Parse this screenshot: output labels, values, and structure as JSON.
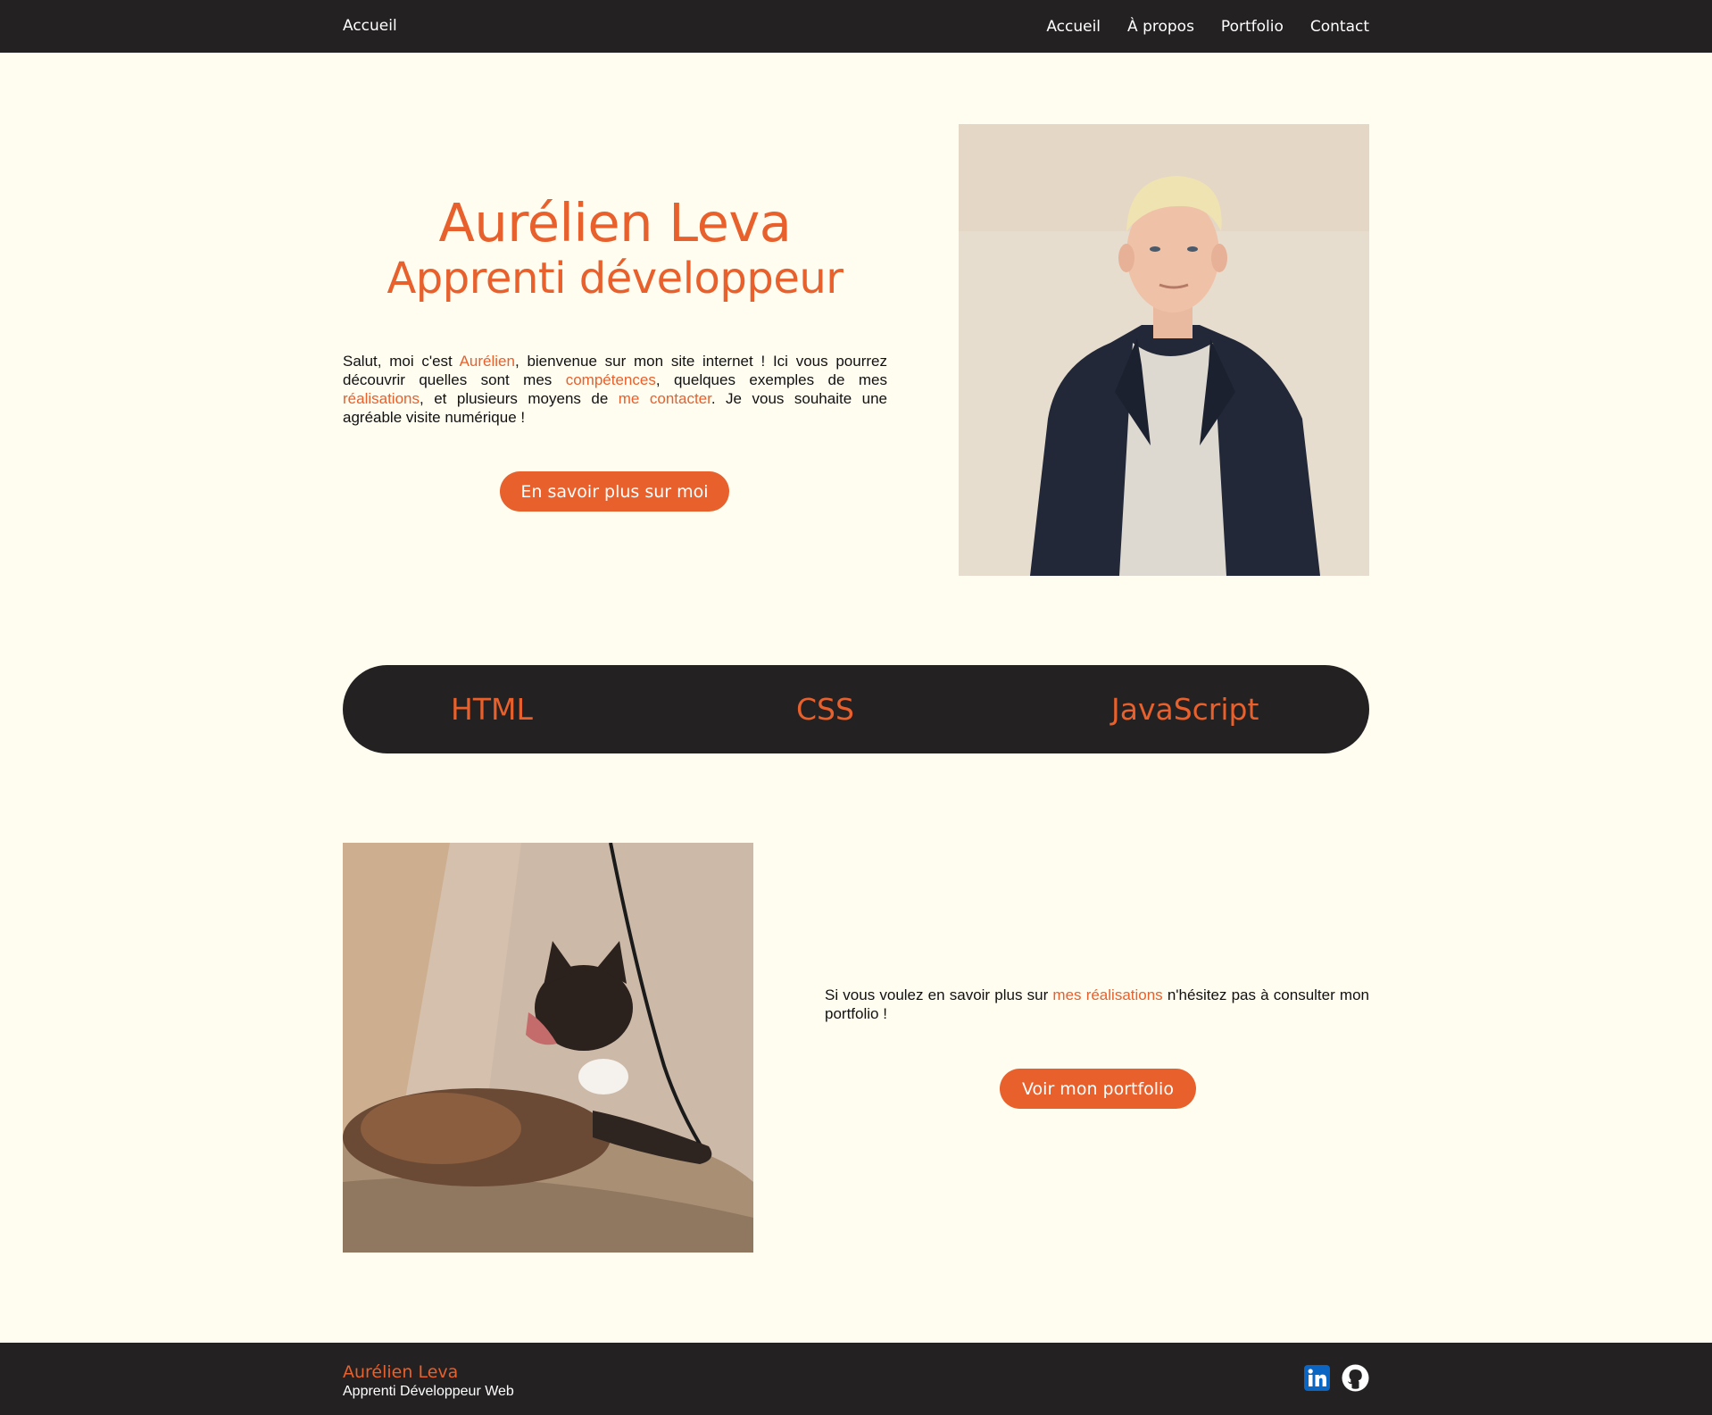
{
  "nav": {
    "home": "Accueil",
    "links": [
      "Accueil",
      "À propos",
      "Portfolio",
      "Contact"
    ]
  },
  "hero": {
    "name": "Aurélien Leva",
    "role": "Apprenti développeur",
    "intro": {
      "t1": "Salut, moi c'est ",
      "link_name": "Aurélien",
      "t2": ", bienvenue sur mon site internet ! Ici vous pourrez découvrir quelles sont mes ",
      "link_skills": "compétences",
      "t3": ", quelques exemples de mes ",
      "link_works": "réalisations",
      "t4": ", et plusieurs moyens de ",
      "link_contact": "me contacter",
      "t5": ". Je vous souhaite une agréable visite numérique !"
    },
    "button": "En savoir plus sur moi"
  },
  "skills": [
    "HTML",
    "CSS",
    "JavaScript"
  ],
  "portfolio": {
    "t1": "Si vous voulez en savoir plus sur ",
    "link": "mes réalisations",
    "t2": " n'hésitez pas à consulter mon portfolio !",
    "button": "Voir mon portfolio"
  },
  "footer": {
    "name": "Aurélien Leva",
    "role": "Apprenti Développeur Web",
    "icons": [
      "linkedin-icon",
      "github-icon"
    ]
  },
  "colors": {
    "accent": "#e8602c",
    "dark": "#232121",
    "background": "#fffcf0"
  }
}
